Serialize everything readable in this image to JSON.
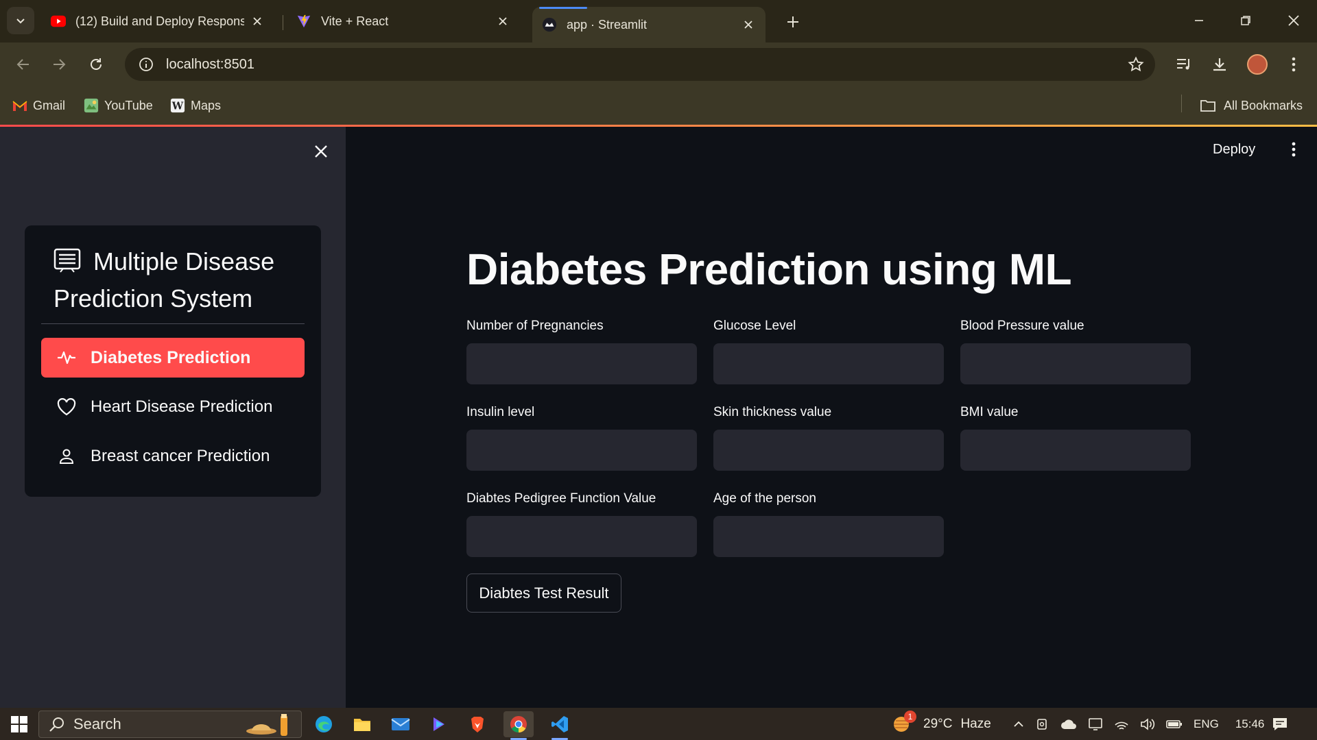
{
  "browser": {
    "tabs": [
      {
        "title": "(12) Build and Deploy Responsi",
        "icon": "youtube-icon"
      },
      {
        "title": "Vite + React",
        "icon": "vite-icon"
      },
      {
        "title": "app · Streamlit",
        "icon": "streamlit-icon",
        "active": true
      }
    ],
    "url": "localhost:8501",
    "bookmarks": [
      {
        "label": "Gmail",
        "icon": "gmail-icon"
      },
      {
        "label": "YouTube",
        "icon": "youtube-bookmark-icon"
      },
      {
        "label": "Maps",
        "icon": "maps-icon"
      }
    ],
    "all_bookmarks": "All Bookmarks"
  },
  "header": {
    "deploy_label": "Deploy"
  },
  "sidebar": {
    "menu_title": "Multiple Disease Prediction System",
    "items": [
      {
        "label": "Diabetes Prediction",
        "icon": "activity-icon",
        "active": true
      },
      {
        "label": "Heart Disease Prediction",
        "icon": "heart-icon"
      },
      {
        "label": "Breast cancer Prediction",
        "icon": "person-icon"
      }
    ]
  },
  "main": {
    "title": "Diabetes Prediction using ML",
    "fields": [
      {
        "label": "Number of Pregnancies",
        "value": ""
      },
      {
        "label": "Glucose Level",
        "value": ""
      },
      {
        "label": "Blood Pressure value",
        "value": ""
      },
      {
        "label": "Insulin level",
        "value": ""
      },
      {
        "label": "Skin thickness value",
        "value": ""
      },
      {
        "label": "BMI value",
        "value": ""
      },
      {
        "label": "Diabtes Pedigree Function Value",
        "value": ""
      },
      {
        "label": "Age of the person",
        "value": ""
      }
    ],
    "submit_label": "Diabtes Test Result"
  },
  "taskbar": {
    "search_label": "Search",
    "weather": "29°C",
    "weather_desc": "Haze",
    "weather_badge": "1",
    "language": "ENG",
    "time": "15:46"
  },
  "colors": {
    "accent": "#ff4b4b",
    "app_bg": "#0e1117",
    "sidebar_bg": "#262730",
    "input_bg": "#262730"
  }
}
